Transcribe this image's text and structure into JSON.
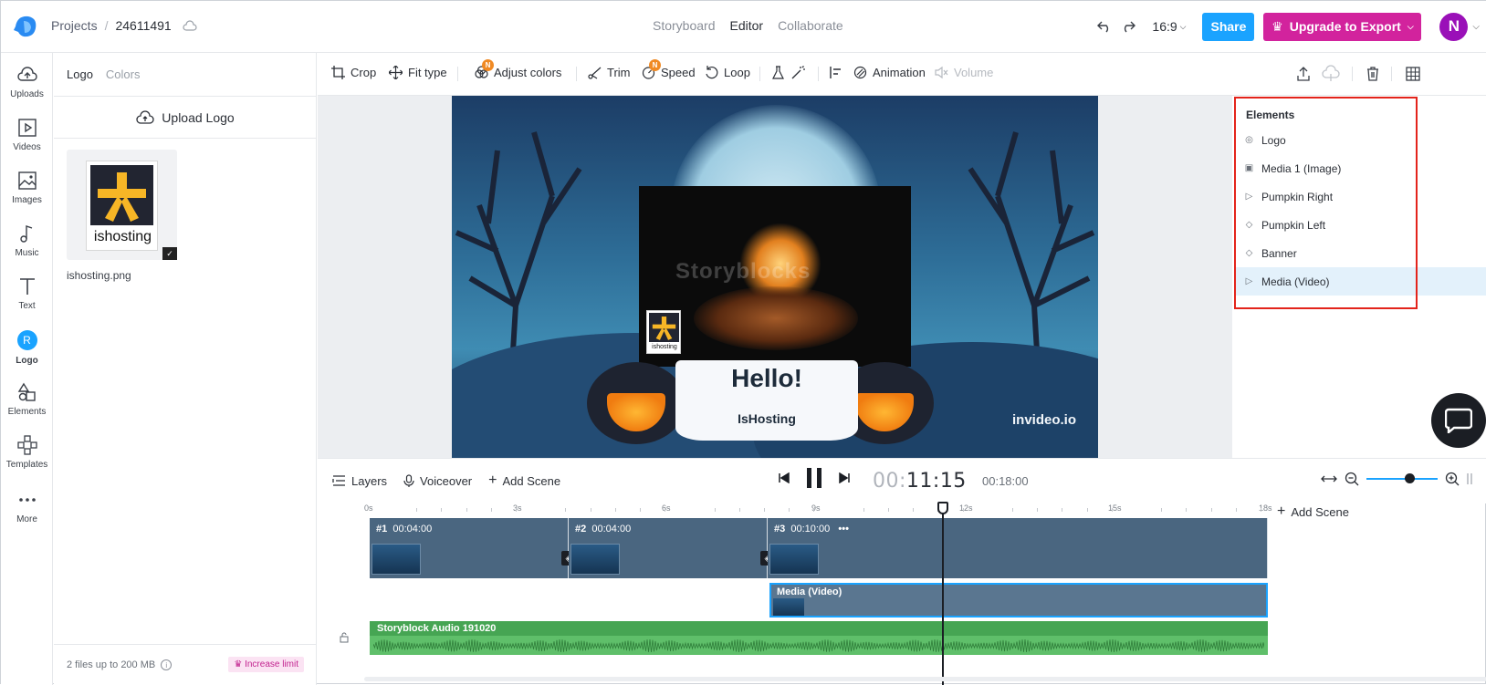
{
  "header": {
    "projects_label": "Projects",
    "separator": "/",
    "project_id": "24611491",
    "modes": [
      "Storyboard",
      "Editor",
      "Collaborate"
    ],
    "active_mode": "Editor",
    "aspect_ratio": "16:9",
    "share_label": "Share",
    "upgrade_label": "Upgrade to Export",
    "avatar_initial": "N"
  },
  "rail": {
    "items": [
      {
        "label": "Uploads",
        "icon": "upload-icon"
      },
      {
        "label": "Videos",
        "icon": "video-icon"
      },
      {
        "label": "Images",
        "icon": "image-icon"
      },
      {
        "label": "Music",
        "icon": "music-icon"
      },
      {
        "label": "Text",
        "icon": "text-icon"
      },
      {
        "label": "Logo",
        "icon": "logo-r-icon",
        "glyph": "R"
      },
      {
        "label": "Elements",
        "icon": "shapes-icon"
      },
      {
        "label": "Templates",
        "icon": "templates-icon"
      },
      {
        "label": "More",
        "icon": "more-icon"
      }
    ]
  },
  "logo_panel": {
    "tabs": [
      "Logo",
      "Colors"
    ],
    "upload_label": "Upload Logo",
    "logo_caption": "ishosting",
    "file_name": "ishosting.png",
    "footer_text": "2 files up to 200 MB",
    "increase_label": "Increase limit"
  },
  "toolbar": {
    "items": [
      "Crop",
      "Fit type",
      "Adjust colors",
      "Trim",
      "Speed",
      "Loop",
      "Animation",
      "Volume"
    ],
    "new_badge": "N"
  },
  "canvas": {
    "watermark": "Storyblocks",
    "mini_logo_caption": "ishosting",
    "banner_title": "Hello!",
    "banner_subtitle": "IsHosting",
    "brand_watermark": "invideo.io"
  },
  "elements_panel": {
    "title": "Elements",
    "items": [
      {
        "label": "Logo",
        "icon": "logo-layer-icon",
        "glyph": "◎"
      },
      {
        "label": "Media 1 (Image)",
        "icon": "image-layer-icon",
        "glyph": "▣"
      },
      {
        "label": "Pumpkin Right",
        "icon": "play-layer-icon",
        "glyph": "▷"
      },
      {
        "label": "Pumpkin Left",
        "icon": "diamond-layer-icon",
        "glyph": "◇"
      },
      {
        "label": "Banner",
        "icon": "diamond-layer-icon",
        "glyph": "◇"
      },
      {
        "label": "Media (Video)",
        "icon": "play-layer-icon",
        "glyph": "▷"
      }
    ],
    "selected": "Media (Video)",
    "highlight_color": "#e3241b"
  },
  "timeline": {
    "layers_label": "Layers",
    "voiceover_label": "Voiceover",
    "add_scene_label": "Add Scene",
    "current_time_dim": "00:",
    "current_time": "11:15",
    "total_time": "00:18:00",
    "ruler_labels": [
      "0s",
      "3s",
      "6s",
      "9s",
      "12s",
      "15s",
      "18s"
    ],
    "scenes": [
      {
        "number": "#1",
        "duration": "00:04:00"
      },
      {
        "number": "#2",
        "duration": "00:04:00"
      },
      {
        "number": "#3",
        "duration": "00:10:00",
        "menu": "•••"
      }
    ],
    "timeline_add_scene": "Add Scene",
    "media_track_label": "Media (Video)",
    "audio_track_label": "Storyblock Audio 191020",
    "zoom_level": 0.6
  },
  "colors": {
    "accent": "#1aa3ff",
    "upgrade": "#d2239d",
    "avatar": "#9a10b8",
    "scene": "#4a6680",
    "audio": "#5fbf6a"
  }
}
